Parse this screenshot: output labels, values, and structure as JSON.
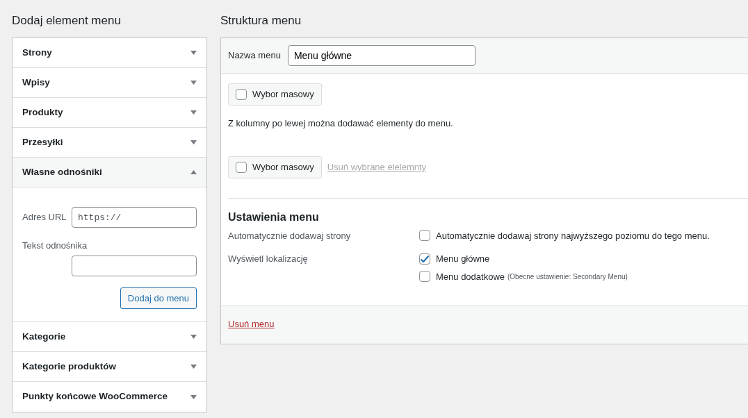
{
  "left_panel": {
    "title": "Dodaj element menu",
    "sections": [
      {
        "label": "Strony",
        "expanded": false
      },
      {
        "label": "Wpisy",
        "expanded": false
      },
      {
        "label": "Produkty",
        "expanded": false
      },
      {
        "label": "Przesyłki",
        "expanded": false
      },
      {
        "label": "Własne odnośniki",
        "expanded": true,
        "form": {
          "url_label": "Adres URL",
          "url_value": "https://",
          "text_label": "Tekst odnośnika",
          "button": "Dodaj do menu"
        }
      },
      {
        "label": "Kategorie",
        "expanded": false
      },
      {
        "label": "Kategorie produktów",
        "expanded": false
      },
      {
        "label": "Punkty końcowe WooCommerce",
        "expanded": false
      }
    ]
  },
  "structure": {
    "title": "Struktura menu",
    "menu_name_label": "Nazwa menu",
    "menu_name_value": "Menu główne",
    "bulk_top": {
      "label": "Wybor masowy",
      "checked": false
    },
    "hint": "Z kolumny po lewej można dodawać elementy do menu.",
    "bulk_bottom": {
      "label": "Wybor masowy",
      "checked": false
    },
    "remove_selected": {
      "label": "Usuń wybrane elelemnty",
      "disabled": true
    },
    "settings": {
      "title": "Ustawienia menu",
      "rows": [
        {
          "label": "Automatycznie dodawaj strony",
          "options": [
            {
              "label": "Automatycznie dodawaj strony najwyższego poziomu do tego menu.",
              "checked": false
            }
          ]
        },
        {
          "label": "Wyświetl lokalizację",
          "options": [
            {
              "label": "Menu główne",
              "checked": true
            },
            {
              "label": "Menu dodatkowe",
              "note": "(Obecne ustawienie: Secondary Menu)",
              "checked": false
            }
          ]
        }
      ]
    },
    "delete_link": "Usuń menu"
  }
}
